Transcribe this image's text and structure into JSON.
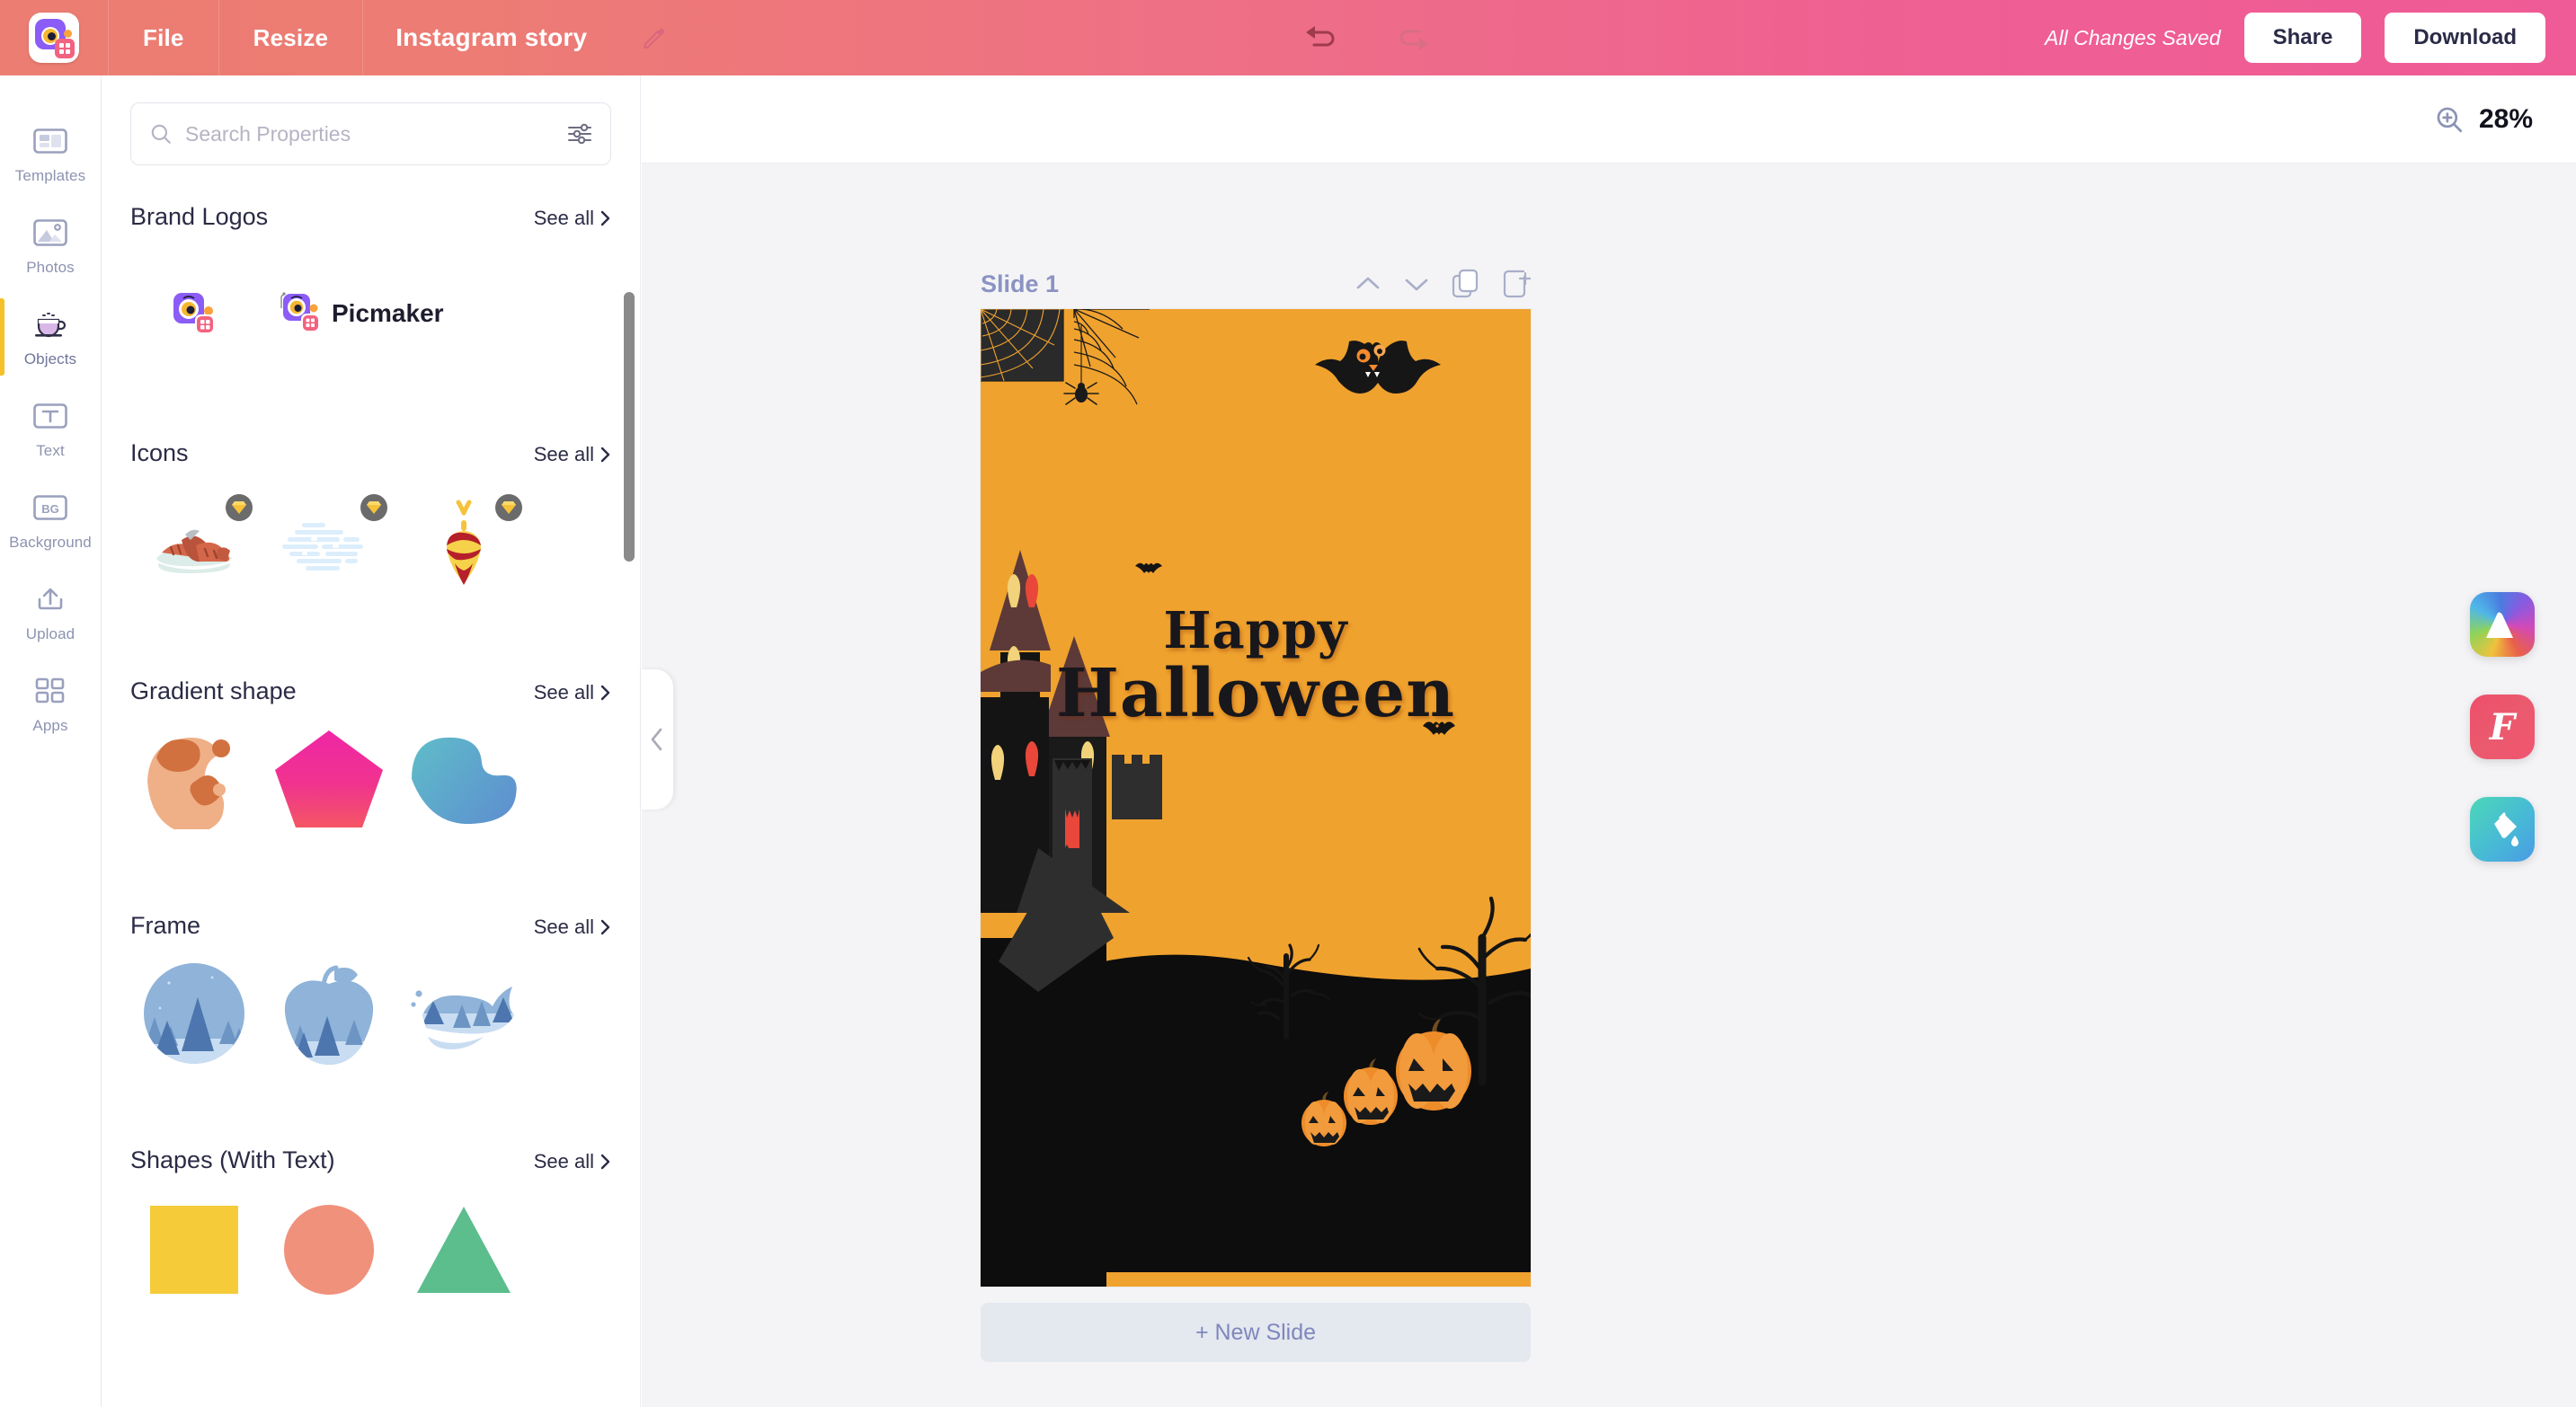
{
  "topbar": {
    "logo_icon": "picmaker-logo-icon",
    "menu": [
      {
        "id": "file",
        "label": "File"
      },
      {
        "id": "resize",
        "label": "Resize"
      }
    ],
    "doc_title": "Instagram story",
    "edit_icon": "pencil-icon",
    "undo_icon": "undo-arrow-icon",
    "redo_icon": "redo-arrow-icon",
    "save_status": "All Changes Saved",
    "share_label": "Share",
    "download_label": "Download"
  },
  "rail": {
    "items": [
      {
        "id": "templates",
        "label": "Templates",
        "icon": "templates-icon",
        "active": false
      },
      {
        "id": "photos",
        "label": "Photos",
        "icon": "photos-icon",
        "active": false
      },
      {
        "id": "objects",
        "label": "Objects",
        "icon": "objects-cup-icon",
        "active": true
      },
      {
        "id": "text",
        "label": "Text",
        "icon": "text-icon",
        "active": false
      },
      {
        "id": "background",
        "label": "Background",
        "icon": "background-bg-icon",
        "active": false
      },
      {
        "id": "upload",
        "label": "Upload",
        "icon": "upload-arrow-icon",
        "active": false
      },
      {
        "id": "apps",
        "label": "Apps",
        "icon": "apps-grid-icon",
        "active": false
      }
    ]
  },
  "panel": {
    "search": {
      "placeholder": "Search Properties",
      "value": "",
      "search_icon": "search-icon",
      "filter_icon": "filter-sliders-icon"
    },
    "see_all_label": "See all",
    "chevron_icon": "chevron-right-icon",
    "sections": [
      {
        "id": "brand-logos",
        "title": "Brand Logos",
        "items": [
          {
            "id": "picmaker-mark",
            "name": "picmaker-logo-mark",
            "premium": false
          },
          {
            "id": "picmaker-wordmark",
            "name": "picmaker-wordmark",
            "label": "Picmaker",
            "premium": false
          }
        ]
      },
      {
        "id": "icons",
        "title": "Icons",
        "items": [
          {
            "id": "grilled-sausage",
            "name": "grilled-sausage-icon",
            "premium": true
          },
          {
            "id": "snow-cloud",
            "name": "snow-cloud-icon",
            "premium": true
          },
          {
            "id": "spinning-top",
            "name": "spinning-top-icon",
            "premium": true
          }
        ]
      },
      {
        "id": "gradient-shape",
        "title": "Gradient shape",
        "items": [
          {
            "id": "blob-peach",
            "name": "peach-blob-shape",
            "premium": false
          },
          {
            "id": "pentagon-pink",
            "name": "pink-pentagon-shape",
            "premium": false
          },
          {
            "id": "blob-blue",
            "name": "blue-bean-shape",
            "premium": false
          }
        ]
      },
      {
        "id": "frame",
        "title": "Frame",
        "items": [
          {
            "id": "circle-forest",
            "name": "circle-forest-frame",
            "premium": false
          },
          {
            "id": "apple-forest",
            "name": "apple-forest-frame",
            "premium": false
          },
          {
            "id": "whale-forest",
            "name": "whale-forest-frame",
            "premium": false
          }
        ]
      },
      {
        "id": "shapes-with-text",
        "title": "Shapes (With Text)",
        "items": [
          {
            "id": "square-yellow",
            "name": "yellow-square-shape",
            "premium": false
          },
          {
            "id": "circle-salmon",
            "name": "salmon-circle-shape",
            "premium": false
          },
          {
            "id": "triangle-green",
            "name": "green-triangle-shape",
            "premium": false
          }
        ]
      }
    ],
    "collapse_icon": "chevron-left-icon"
  },
  "stage": {
    "zoom_icon": "zoom-in-icon",
    "zoom_value": "28%",
    "slide_label": "Slide 1",
    "slide_tools": [
      {
        "id": "move-up",
        "icon": "chevron-up-icon"
      },
      {
        "id": "move-down",
        "icon": "chevron-down-icon"
      },
      {
        "id": "duplicate",
        "icon": "duplicate-slide-icon"
      },
      {
        "id": "add",
        "icon": "add-slide-icon"
      }
    ],
    "new_slide_label": "+ New Slide"
  },
  "canvas": {
    "background_color": "#f0a22e",
    "title_line1": "Happy",
    "title_line2": "Halloween",
    "elements": [
      "spider-web-corner",
      "hanging-spider",
      "large-bat",
      "small-bat-left",
      "small-bat-right",
      "haunted-house",
      "bare-tree-center",
      "bare-tree-right",
      "jack-o-lanterns",
      "dark-hill"
    ]
  },
  "fabs": [
    {
      "id": "mountain-app",
      "icon": "rainbow-mountain-icon"
    },
    {
      "id": "font-app",
      "icon": "font-f-icon"
    },
    {
      "id": "fill-app",
      "icon": "paint-bucket-icon"
    }
  ]
}
